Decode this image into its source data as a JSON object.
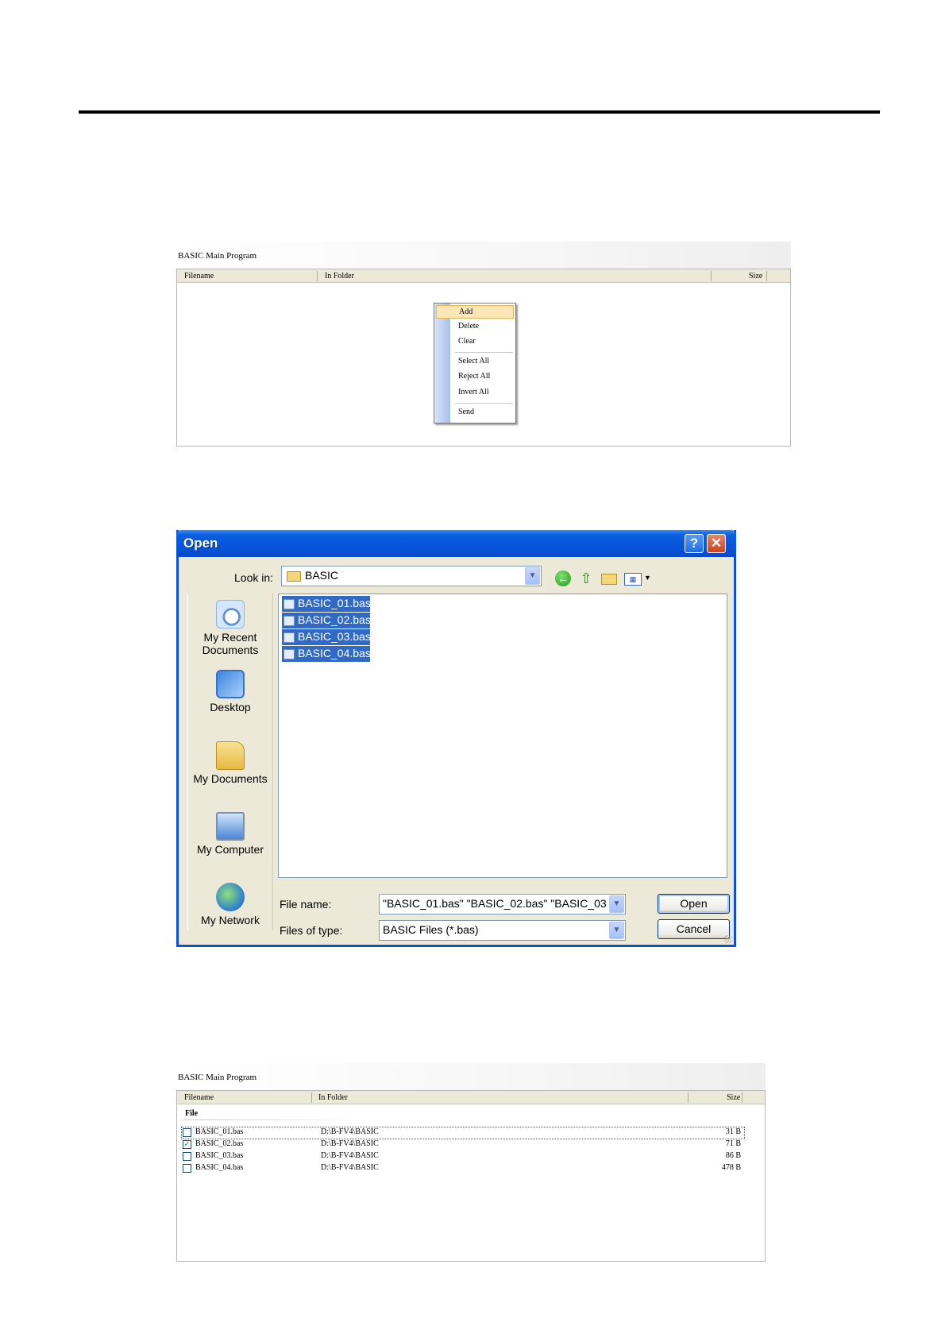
{
  "panel1": {
    "title": "BASIC Main Program",
    "columns": [
      "Filename",
      "In Folder",
      "Size"
    ]
  },
  "context_menu": {
    "items": [
      "Add",
      "Delete",
      "Clear",
      "Select All",
      "Reject All",
      "Invert All",
      "Send"
    ],
    "highlighted": "Add"
  },
  "dialog": {
    "title": "Open",
    "help_glyph": "?",
    "close_glyph": "✕",
    "look_in_label": "Look in:",
    "look_in_value": "BASIC",
    "places": [
      "My Recent Documents",
      "Desktop",
      "My Documents",
      "My Computer",
      "My Network"
    ],
    "files": [
      "BASIC_01.bas",
      "BASIC_02.bas",
      "BASIC_03.bas",
      "BASIC_04.bas"
    ],
    "file_name_label": "File name:",
    "file_name_value": "\"BASIC_01.bas\" \"BASIC_02.bas\" \"BASIC_03",
    "files_of_type_label": "Files of type:",
    "files_of_type_value": "BASIC Files (*.bas)",
    "open_button": "Open",
    "cancel_button": "Cancel",
    "icons": [
      "back-icon",
      "up-folder-icon",
      "new-folder-icon",
      "views-menu-icon"
    ]
  },
  "panel2": {
    "title": "BASIC Main Program",
    "columns": [
      "Filename",
      "In Folder",
      "Size"
    ],
    "group": "File",
    "rows": [
      {
        "name": "BASIC_01.bas",
        "folder": "D:\\B-FV4\\BASIC",
        "size": "31 B",
        "checked": false
      },
      {
        "name": "BASIC_02.bas",
        "folder": "D:\\B-FV4\\BASIC",
        "size": "71 B",
        "checked": true
      },
      {
        "name": "BASIC_03.bas",
        "folder": "D:\\B-FV4\\BASIC",
        "size": "86 B",
        "checked": false
      },
      {
        "name": "BASIC_04.bas",
        "folder": "D:\\B-FV4\\BASIC",
        "size": "478 B",
        "checked": false
      }
    ]
  }
}
